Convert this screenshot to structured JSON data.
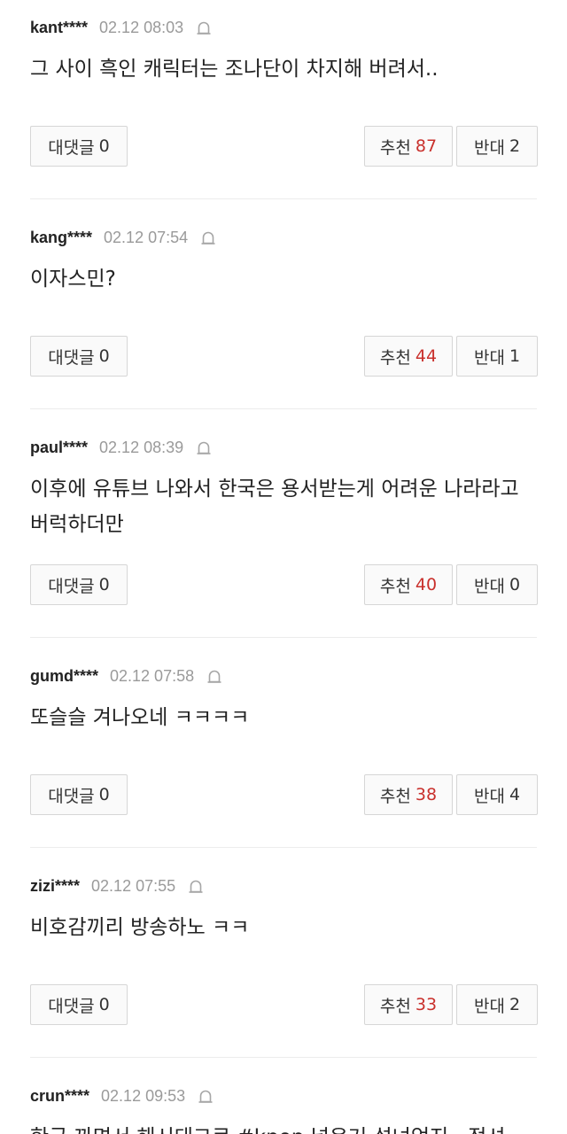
{
  "labels": {
    "reply": "대댓글",
    "recommend": "추천",
    "oppose": "반대"
  },
  "comments": [
    {
      "user": "kant****",
      "date": "02.12 08:03",
      "text": "그 사이 흑인 캐릭터는 조나단이 차지해 버려서..",
      "replies": "0",
      "recommend": "87",
      "oppose": "2"
    },
    {
      "user": "kang****",
      "date": "02.12 07:54",
      "text": "이자스민?",
      "replies": "0",
      "recommend": "44",
      "oppose": "1"
    },
    {
      "user": "paul****",
      "date": "02.12 08:39",
      "text": "이후에 유튜브 나와서 한국은 용서받는게 어려운 나라라고 버럭하더만",
      "replies": "0",
      "recommend": "40",
      "oppose": "0"
    },
    {
      "user": "gumd****",
      "date": "02.12 07:58",
      "text": "또슬슬 겨나오네 ㅋㅋㅋㅋ",
      "replies": "0",
      "recommend": "38",
      "oppose": "4"
    },
    {
      "user": "zizi****",
      "date": "02.12 07:55",
      "text": "비호감끼리 방송하노 ㅋㅋ",
      "replies": "0",
      "recommend": "33",
      "oppose": "2"
    },
    {
      "user": "crun****",
      "date": "02.12 09:53",
      "text": "한국 까면서 해시태그로 #kpop 넣은거 설녀얻지.. 정셔",
      "replies": "",
      "recommend": "",
      "oppose": ""
    }
  ],
  "icons": {
    "report": "report-siren-icon"
  },
  "colors": {
    "recommend_count": "#c9302c",
    "date": "#9a9a9a",
    "button_border": "#d6d6d6"
  }
}
